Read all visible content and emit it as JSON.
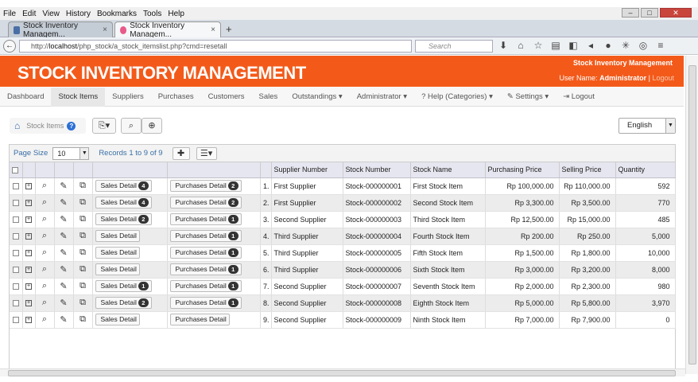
{
  "browser": {
    "menu": [
      "File",
      "Edit",
      "View",
      "History",
      "Bookmarks",
      "Tools",
      "Help"
    ],
    "tabs": [
      {
        "title": "Stock Inventory Managem...",
        "active": false,
        "close": "×"
      },
      {
        "title": "Stock Inventory Managem...",
        "active": true,
        "close": "×"
      }
    ],
    "new_tab": "+",
    "url_prefix": "http://",
    "url_host": "localhost",
    "url_path": "/php_stock/a_stock_itemslist.php?cmd=resetall",
    "search_placeholder": "Search"
  },
  "app": {
    "title": "STOCK INVENTORY MANAGEMENT",
    "header_right_title": "Stock Inventory Management",
    "user_label": "User Name:",
    "user_name": "Administrator",
    "logout_link": "Logout",
    "accent_color": "#f35a1a"
  },
  "nav": [
    {
      "label": "Dashboard",
      "active": false
    },
    {
      "label": "Stock Items",
      "active": true
    },
    {
      "label": "Suppliers",
      "active": false
    },
    {
      "label": "Purchases",
      "active": false
    },
    {
      "label": "Customers",
      "active": false
    },
    {
      "label": "Sales",
      "active": false
    },
    {
      "label": "Outstandings ▾",
      "active": false
    },
    {
      "label": "Administrator ▾",
      "active": false
    },
    {
      "label": "? Help (Categories) ▾",
      "active": false
    },
    {
      "label": "✎ Settings ▾",
      "active": false
    },
    {
      "label": "⇥ Logout",
      "active": false
    }
  ],
  "breadcrumb": {
    "label": "Stock Items",
    "help": "?"
  },
  "language": {
    "selected": "English"
  },
  "pager": {
    "page_size_label": "Page Size",
    "page_size": "10",
    "records": "Records 1 to 9 of 9"
  },
  "table": {
    "headers": [
      "Supplier Number",
      "Stock Number",
      "Stock Name",
      "Purchasing Price",
      "Selling Price",
      "Quantity"
    ],
    "rows": [
      {
        "no": "1.",
        "sales": "Sales Detail",
        "sales_badge": "4",
        "purchases": "Purchases Detail",
        "purchases_badge": "2",
        "supplier": "First Supplier",
        "stock_number": "Stock-000000001",
        "stock_name": "First Stock Item",
        "purchasing": "Rp 100,000.00",
        "selling": "Rp 110,000.00",
        "qty": "592"
      },
      {
        "no": "2.",
        "sales": "Sales Detail",
        "sales_badge": "4",
        "purchases": "Purchases Detail",
        "purchases_badge": "2",
        "supplier": "First Supplier",
        "stock_number": "Stock-000000002",
        "stock_name": "Second Stock Item",
        "purchasing": "Rp 3,300.00",
        "selling": "Rp 3,500.00",
        "qty": "770"
      },
      {
        "no": "3.",
        "sales": "Sales Detail",
        "sales_badge": "2",
        "purchases": "Purchases Detail",
        "purchases_badge": "1",
        "supplier": "Second Supplier",
        "stock_number": "Stock-000000003",
        "stock_name": "Third Stock Item",
        "purchasing": "Rp 12,500.00",
        "selling": "Rp 15,000.00",
        "qty": "485"
      },
      {
        "no": "4.",
        "sales": "Sales Detail",
        "sales_badge": "",
        "purchases": "Purchases Detail",
        "purchases_badge": "1",
        "supplier": "Third Supplier",
        "stock_number": "Stock-000000004",
        "stock_name": "Fourth Stock Item",
        "purchasing": "Rp 200.00",
        "selling": "Rp 250.00",
        "qty": "5,000"
      },
      {
        "no": "5.",
        "sales": "Sales Detail",
        "sales_badge": "",
        "purchases": "Purchases Detail",
        "purchases_badge": "1",
        "supplier": "Third Supplier",
        "stock_number": "Stock-000000005",
        "stock_name": "Fifth Stock Item",
        "purchasing": "Rp 1,500.00",
        "selling": "Rp 1,800.00",
        "qty": "10,000"
      },
      {
        "no": "6.",
        "sales": "Sales Detail",
        "sales_badge": "",
        "purchases": "Purchases Detail",
        "purchases_badge": "1",
        "supplier": "Third Supplier",
        "stock_number": "Stock-000000006",
        "stock_name": "Sixth Stock Item",
        "purchasing": "Rp 3,000.00",
        "selling": "Rp 3,200.00",
        "qty": "8,000"
      },
      {
        "no": "7.",
        "sales": "Sales Detail",
        "sales_badge": "1",
        "purchases": "Purchases Detail",
        "purchases_badge": "1",
        "supplier": "Second Supplier",
        "stock_number": "Stock-000000007",
        "stock_name": "Seventh Stock Item",
        "purchasing": "Rp 2,000.00",
        "selling": "Rp 2,300.00",
        "qty": "980"
      },
      {
        "no": "8.",
        "sales": "Sales Detail",
        "sales_badge": "2",
        "purchases": "Purchases Detail",
        "purchases_badge": "1",
        "supplier": "Second Supplier",
        "stock_number": "Stock-000000008",
        "stock_name": "Eighth Stock Item",
        "purchasing": "Rp 5,000.00",
        "selling": "Rp 5,800.00",
        "qty": "3,970"
      },
      {
        "no": "9.",
        "sales": "Sales Detail",
        "sales_badge": "",
        "purchases": "Purchases Detail",
        "purchases_badge": "",
        "supplier": "Second Supplier",
        "stock_number": "Stock-000000009",
        "stock_name": "Ninth Stock Item",
        "purchasing": "Rp 7,000.00",
        "selling": "Rp 7,900.00",
        "qty": "0"
      }
    ]
  }
}
